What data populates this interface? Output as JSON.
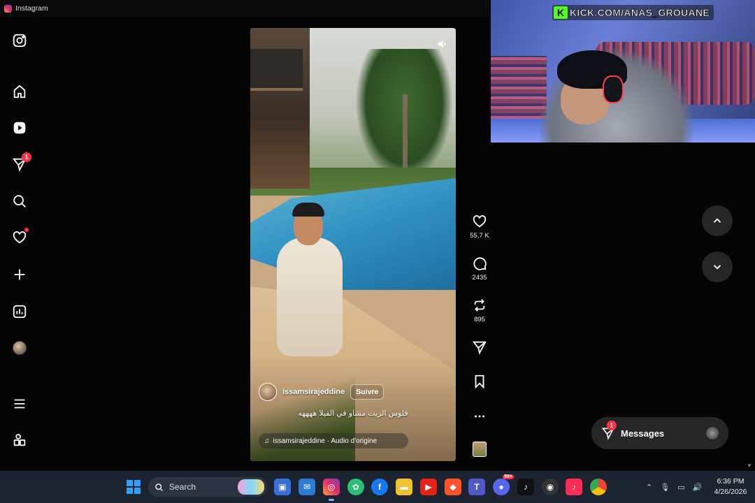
{
  "window": {
    "title": "Instagram"
  },
  "sidebar": {
    "items": [
      {
        "name": "instagram-logo-icon"
      },
      {
        "name": "home-icon"
      },
      {
        "name": "reels-icon"
      },
      {
        "name": "messages-icon",
        "badge": "1"
      },
      {
        "name": "search-icon"
      },
      {
        "name": "notifications-icon"
      },
      {
        "name": "create-icon"
      },
      {
        "name": "dashboard-icon"
      },
      {
        "name": "profile-avatar"
      },
      {
        "name": "menu-icon"
      },
      {
        "name": "more-apps-icon"
      }
    ]
  },
  "reel": {
    "username": "issamsirajeddine",
    "follow_label": "Suivre",
    "caption": "فلوس الزيت مشاو في الفيلا ههههه",
    "audio": "issamsirajeddine · Audio d'origine",
    "actions": {
      "likes": "55,7 K",
      "comments": "2435",
      "reposts": "895"
    }
  },
  "webcam": {
    "overlay_text": "KICK.COM/ANAS_GROUANE",
    "logo_letter": "K"
  },
  "messages": {
    "label": "Messages",
    "badge": "1"
  },
  "taskbar": {
    "search_label": "Search",
    "clock_time": "6:36 PM",
    "clock_date": "4/26/2026",
    "discord_badge": "99+"
  },
  "colors": {
    "background": "#000000",
    "accent_badge": "#ff3040",
    "kick_green": "#53fc18",
    "taskbar": "#1c2431"
  }
}
